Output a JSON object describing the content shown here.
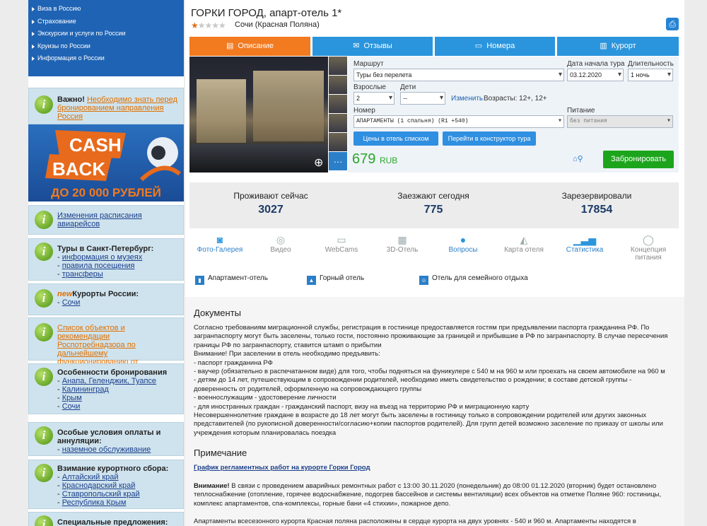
{
  "left_nav": [
    "Виза в Россию",
    "Страхование",
    "Экскурсии и услуги по России",
    "Круизы по России",
    "Информация о России"
  ],
  "banner": {
    "line1": "CASH",
    "line2": "BACK",
    "amount": "ДО 20 000 РУБЛЕЙ"
  },
  "boxes": {
    "important": {
      "title": "Важно!",
      "link": "Необходимо знать перед бронированием направления Россия"
    },
    "schedule": {
      "link": "Изменения расписания авиарейсов"
    },
    "spb": {
      "title": "Туры в Санкт-Петербург:",
      "items": [
        "информация о музеях",
        "правила посещения",
        "трансферы"
      ]
    },
    "resorts": {
      "new": "new",
      "title": "Курорты России:",
      "items": [
        "Сочи"
      ]
    },
    "rospotreb": {
      "link": "Список объектов и рекомендации Роспотребнадзора по дальнейшему функционированию от 01.06.2020"
    },
    "booking": {
      "title": "Особенности бронирования",
      "items": [
        "Анапа, Геленджик, Туапсе",
        "Калининград",
        "Крым",
        "Сочи"
      ]
    },
    "payment": {
      "title": "Особые условия оплаты и аннуляции:",
      "items": [
        "наземное обслуживание"
      ]
    },
    "fee": {
      "title": "Взимание курортного сбора:",
      "items": [
        "Алтайский край",
        "Краснодарский край",
        "Ставропольский край",
        "Республика Крым"
      ]
    },
    "special": {
      "title": "Специальные предложения:"
    }
  },
  "hotel": {
    "title": "ГОРКИ ГОРОД, апарт-отель 1*",
    "stars": "★",
    "stars_empty": "★★★★",
    "location": "Сочи (Красная Поляна)"
  },
  "tabs": [
    {
      "label": "Описание",
      "icon": "document-icon"
    },
    {
      "label": "Отзывы",
      "icon": "chat-icon"
    },
    {
      "label": "Номера",
      "icon": "bed-icon"
    },
    {
      "label": "Курорт",
      "icon": "city-icon"
    }
  ],
  "form": {
    "route_label": "Маршрут",
    "route_value": "Туры без перелета",
    "date_label": "Дата начала тура",
    "date_value": "03.12.2020",
    "duration_label": "Длительность",
    "duration_value": "1 ночь",
    "adults_label": "Взрослые",
    "adults_value": "2",
    "children_label": "Дети",
    "children_value": "--",
    "change_link": "Изменить",
    "ages": "Возрасты: 12+, 12+",
    "room_label": "Номер",
    "room_value": "АПАРТАМЕНТЫ (1 спальня) (R1 +540)",
    "meal_label": "Питание",
    "meal_value": "без питания",
    "btn_list": "Цены в отель списком",
    "btn_constructor": "Перейти в конструктор тура"
  },
  "price": {
    "amount": "679",
    "currency": "RUB"
  },
  "book_label": "Забронировать",
  "stats": [
    {
      "label": "Проживают сейчас",
      "value": "3027"
    },
    {
      "label": "Заезжают сегодня",
      "value": "775"
    },
    {
      "label": "Зарезервировали",
      "value": "17854"
    }
  ],
  "features": [
    {
      "label": "Фото-Галерея",
      "icon": "camera-icon",
      "active": true
    },
    {
      "label": "Видео",
      "icon": "film-icon",
      "active": false
    },
    {
      "label": "WebCams",
      "icon": "webcam-icon",
      "active": false
    },
    {
      "label": "3D-Отель",
      "icon": "cube-icon",
      "active": false
    },
    {
      "label": "Вопросы",
      "icon": "question-icon",
      "active": true
    },
    {
      "label": "Карта отеля",
      "icon": "map-icon",
      "active": false
    },
    {
      "label": "Статистика",
      "icon": "chart-icon",
      "active": true
    },
    {
      "label": "Концепция питания",
      "icon": "plate-icon",
      "active": false
    }
  ],
  "amenities": [
    "Апартамент-отель",
    "Горный отель",
    "Отель для семейного отдыха"
  ],
  "docs": {
    "title": "Документы",
    "lines": [
      "Согласно требованиям миграционной службы, регистрация в гостинице предоставляется гостям при предъявлении паспорта гражданина РФ. По",
      "загранпаспорту могут быть заселены, только гости, постоянно проживающие за границей и прибывшие в РФ по загранпаспорту. В случае пересечения",
      "границы РФ по загранпаспорту, ставится штамп о прибытии",
      "Внимание! При заселении в отель необходимо предъявить:",
      "- паспорт гражданина РФ",
      "- ваучер (обязательно в распечатанном виде) для того, чтобы подняться на фуникулере с 540 м на 960 м или проехать на своем автомобиле на 960 м",
      "- детям до 14 лет, путешествующим в сопровождении родителей, необходимо иметь свидетельство о рождении; в составе детской группы -",
      "доверенность от родителей, оформленную на сопровождающего группы",
      "- военнослужащим - удостоверение личности",
      "- для иностранных граждан - гражданский паспорт, визу на въезд на территорию РФ и миграционную карту",
      "Несовершеннолетние граждане в возрасте до 18 лет могут быть заселены в гостиницу только в сопровождении родителей или других законных",
      "представителей (по рукописной доверенности/согласию+копии паспортов родителей). Для групп детей возможно заселение по приказу от школы или",
      "учреждения которым планировалась поездка"
    ],
    "note_title": "Примечание",
    "note_link": "График регламентных работ на курорте Горки Город",
    "attention_bold": "Внимание!",
    "attention_lines": [
      " В связи с проведением аварийных ремонтных работ с 13:00 30.11.2020 (понедельник) до 08:00 01.12.2020 (вторник) будет остановлено",
      "теплоснабжение (отопление, горячее водоснабжение, подогрев бассейнов и системы вентиляции) всех объектов на отметке Поляне 960: гостиницы,",
      "комплекс апартаментов, спа-комплексы, горные бани «4 стихии», пожарное депо."
    ],
    "last_line": "Апартаменты всесезонного курорта Красная поляна расположены в сердце курорта на двух уровнях - 540 и 960 м. Апартаменты находятся в"
  }
}
